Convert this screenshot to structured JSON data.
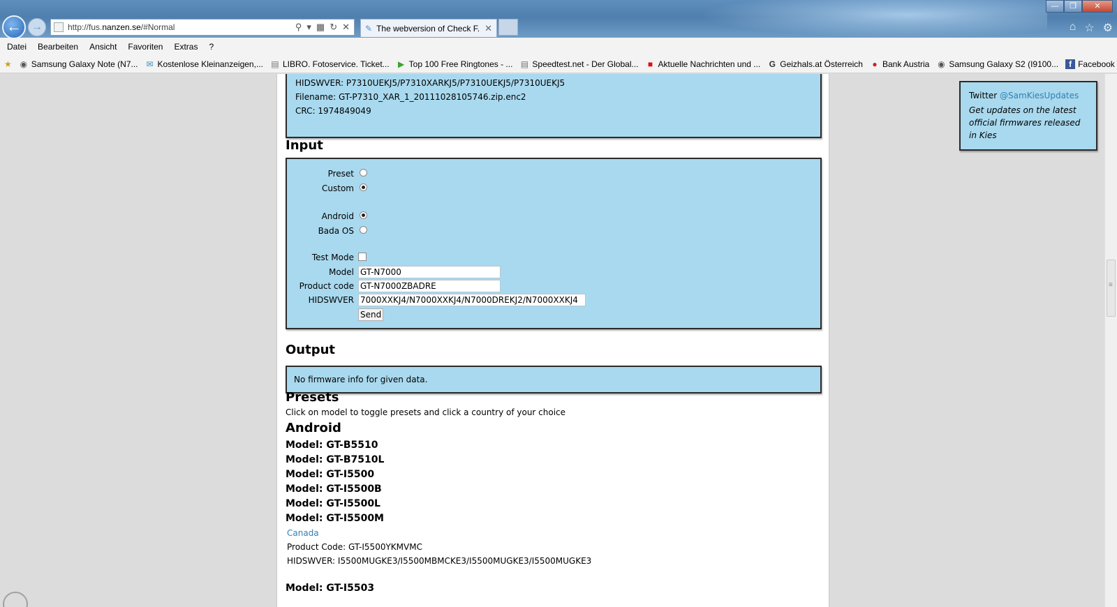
{
  "browser": {
    "url_prefix": "http://fus.",
    "url_domain": "nanzen.se",
    "url_suffix": "/#Normal",
    "tab_title": "The webversion of Check F...",
    "menu": [
      "Datei",
      "Bearbeiten",
      "Ansicht",
      "Favoriten",
      "Extras",
      "?"
    ],
    "favorites": [
      {
        "label": "Samsung Galaxy Note (N7...",
        "icon": "android-icon"
      },
      {
        "label": "Kostenlose Kleinanzeigen,...",
        "icon": "chat-icon"
      },
      {
        "label": "LIBRO. Fotoservice. Ticket...",
        "icon": "page-icon"
      },
      {
        "label": "Top 100 Free Ringtones - ...",
        "icon": "play-icon"
      },
      {
        "label": "Speedtest.net - Der Global...",
        "icon": "page-icon"
      },
      {
        "label": "Aktuelle Nachrichten und ...",
        "icon": "news-icon"
      },
      {
        "label": "Geizhals.at Österreich",
        "icon": "g-icon"
      },
      {
        "label": "Bank Austria",
        "icon": "bank-icon"
      },
      {
        "label": "Samsung Galaxy S2 (I9100...",
        "icon": "android-icon"
      },
      {
        "label": "Facebook",
        "icon": "facebook-icon"
      }
    ]
  },
  "top_info": {
    "hidswver": "HIDSWVER: P7310UEKJ5/P7310XARKJ5/P7310UEKJ5/P7310UEKJ5",
    "filename": "Filename: GT-P7310_XAR_1_20111028105746.zip.enc2",
    "crc": "CRC: 1974849049"
  },
  "input": {
    "heading": "Input",
    "preset_label": "Preset",
    "custom_label": "Custom",
    "android_label": "Android",
    "bada_label": "Bada OS",
    "test_mode_label": "Test Mode",
    "model_label": "Model",
    "model_value": "GT-N7000",
    "product_code_label": "Product code",
    "product_code_value": "GT-N7000ZBADRE",
    "hidswver_label": "HIDSWVER",
    "hidswver_value": "7000XXKJ4/N7000XXKJ4/N7000DREKJ2/N7000XXKJ4",
    "send_label": "Send"
  },
  "output": {
    "heading": "Output",
    "message": "No firmware info for given data."
  },
  "presets": {
    "heading": "Presets",
    "hint": "Click on model to toggle presets and click a country of your choice",
    "android_heading": "Android",
    "models": [
      "Model: GT-B5510",
      "Model: GT-B7510L",
      "Model: GT-I5500",
      "Model: GT-I5500B",
      "Model: GT-I5500L",
      "Model: GT-I5500M"
    ],
    "expanded": {
      "country": "Canada",
      "product_code": "Product Code: GT-I5500YKMVMC",
      "hidswver": "HIDSWVER: I5500MUGKE3/I5500MBMCKE3/I5500MUGKE3/I5500MUGKE3"
    },
    "next_model": "Model: GT-I5503"
  },
  "twitter": {
    "prefix": "Twitter",
    "handle": "@SamKiesUpdates",
    "desc": "Get updates on the latest official firmwares released in Kies"
  }
}
